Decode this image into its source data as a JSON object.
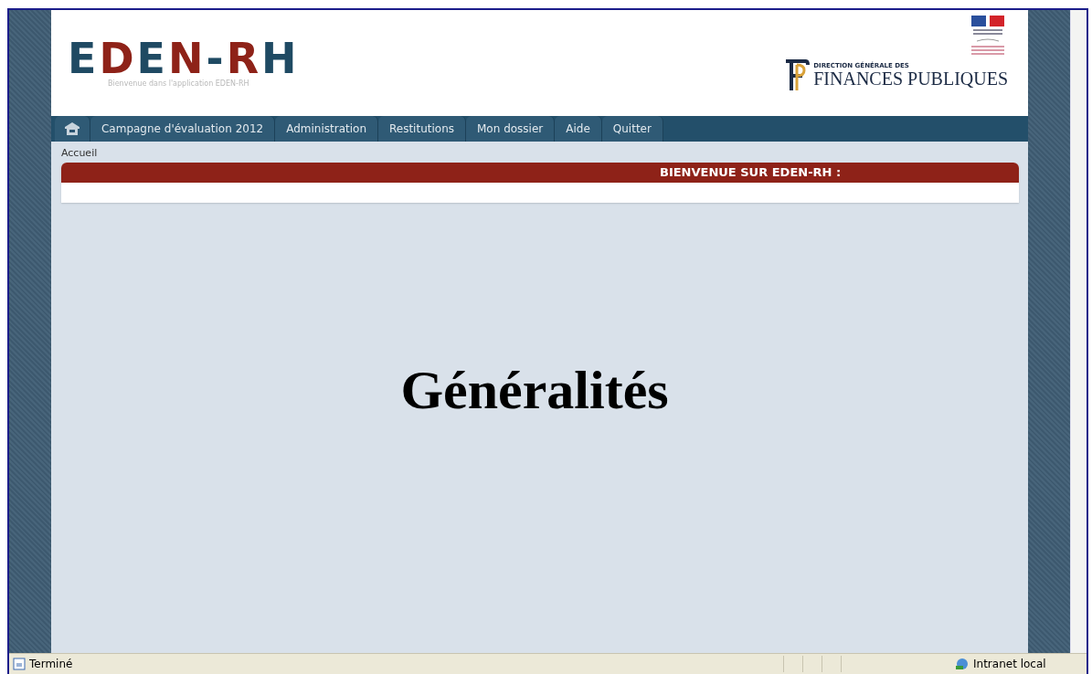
{
  "header": {
    "logo": {
      "text": "EDEN-RH"
    },
    "tagline": "Bienvenue dans l'application EDEN-RH",
    "agency": {
      "line1": "DIRECTION GÉNÉRALE DES",
      "line2": "FINANCES PUBLIQUES"
    }
  },
  "nav": {
    "items": [
      {
        "label": "Campagne d'évaluation 2012",
        "selected": false
      },
      {
        "label": "Administration",
        "selected": false
      },
      {
        "label": "Restitutions",
        "selected": false
      },
      {
        "label": "Mon dossier",
        "selected": false
      },
      {
        "label": "Aide",
        "selected": false
      },
      {
        "label": "Quitter",
        "selected": false
      }
    ]
  },
  "breadcrumb": "Accueil",
  "banner": {
    "title": "BIENVENUE SUR EDEN-RH :"
  },
  "overlay_title": "Généralités",
  "status_bar": {
    "status": "Terminé",
    "zone": "Intranet local"
  }
}
